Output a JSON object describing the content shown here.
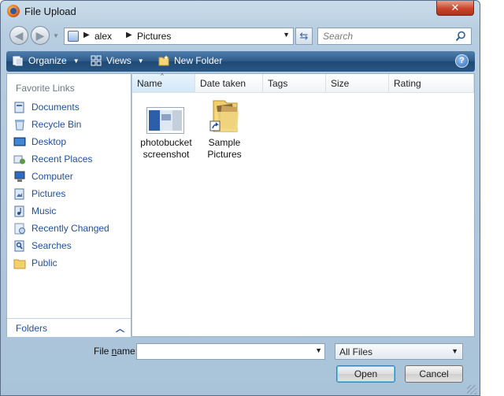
{
  "window": {
    "title": "File Upload",
    "close_glyph": "✕"
  },
  "nav": {
    "back_glyph": "◀",
    "forward_glyph": "▶",
    "address": {
      "segments": [
        "alex",
        "Pictures"
      ]
    },
    "search_placeholder": "Search"
  },
  "toolbar": {
    "organize": "Organize",
    "views": "Views",
    "new_folder": "New Folder",
    "help": "?"
  },
  "sidebar": {
    "header": "Favorite Links",
    "items": [
      {
        "label": "Documents",
        "icon": "documents-icon"
      },
      {
        "label": "Recycle Bin",
        "icon": "recycle-bin-icon"
      },
      {
        "label": "Desktop",
        "icon": "desktop-icon"
      },
      {
        "label": "Recent Places",
        "icon": "recent-places-icon"
      },
      {
        "label": "Computer",
        "icon": "computer-icon"
      },
      {
        "label": "Pictures",
        "icon": "pictures-icon"
      },
      {
        "label": "Music",
        "icon": "music-icon"
      },
      {
        "label": "Recently Changed",
        "icon": "recently-changed-icon"
      },
      {
        "label": "Searches",
        "icon": "searches-icon"
      },
      {
        "label": "Public",
        "icon": "public-folder-icon"
      }
    ],
    "folders_label": "Folders"
  },
  "columns": [
    "Name",
    "Date taken",
    "Tags",
    "Size",
    "Rating"
  ],
  "files": [
    {
      "line1": "photobucket",
      "line2": "screenshot",
      "icon": "screenshot-thumbnail-icon"
    },
    {
      "line1": "Sample",
      "line2": "Pictures",
      "icon": "shortcut-folder-icon"
    }
  ],
  "footer": {
    "file_name_label_prefix": "File ",
    "file_name_label_accel": "n",
    "file_name_label_suffix": "ame:",
    "file_name_value": "",
    "file_type_selected": "All Files",
    "open_label": "Open",
    "cancel_label": "Cancel"
  },
  "colors": {
    "link_blue": "#1f4e9c",
    "toolbar_dark": "#2d5a88",
    "close_red": "#c8452a"
  }
}
